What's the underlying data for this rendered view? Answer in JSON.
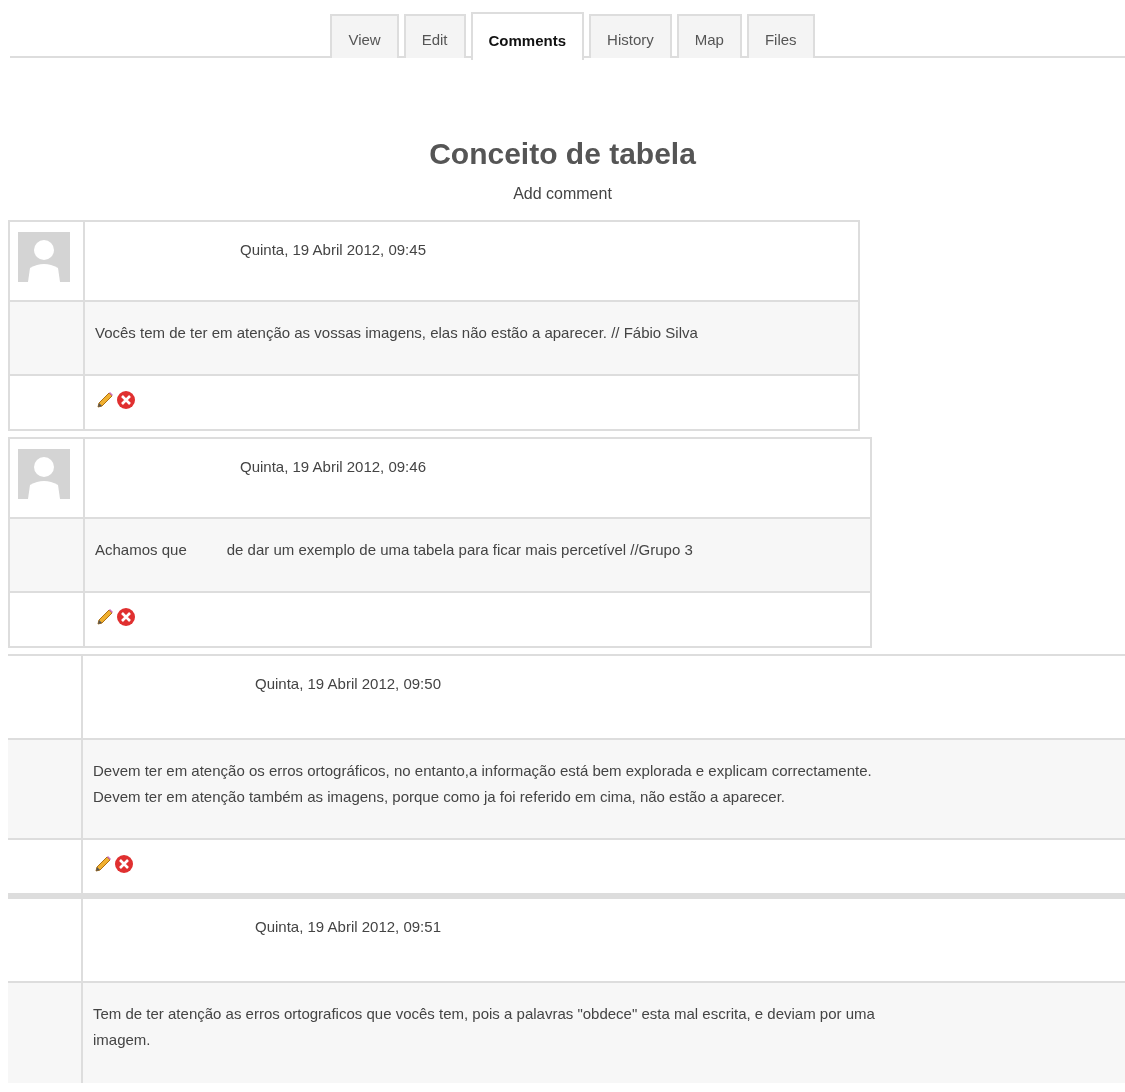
{
  "tabs": [
    {
      "label": "View",
      "selected": false
    },
    {
      "label": "Edit",
      "selected": false
    },
    {
      "label": "Comments",
      "selected": true
    },
    {
      "label": "History",
      "selected": false
    },
    {
      "label": "Map",
      "selected": false
    },
    {
      "label": "Files",
      "selected": false
    }
  ],
  "title": "Conceito de tabela",
  "add_comment": "Add comment",
  "comments": [
    {
      "kind": "avatar",
      "time": "Quinta, 19 Abril 2012, 09:45",
      "text_parts": [
        "Vocês tem de ter em atenção as vossas imagens, elas não estão a aparecer. // Fábio Silva"
      ]
    },
    {
      "kind": "avatar",
      "time": "Quinta, 19 Abril 2012, 09:46",
      "text_parts": [
        "Achamos que",
        "de dar um exemplo de uma tabela para ficar mais percetível  //Grupo 3"
      ]
    },
    {
      "kind": "plain",
      "time": "Quinta, 19 Abril 2012, 09:50",
      "text_parts": [
        "Devem ter em atenção os erros ortográficos, no entanto,a informação está bem explorada e explicam correctamente. Devem ter em atenção também as imagens, porque como ja foi referido em cima, não estão a aparecer."
      ],
      "actions": true
    },
    {
      "kind": "plain",
      "time": "Quinta, 19 Abril 2012, 09:51",
      "text_parts": [
        "Tem de ter atenção as erros ortograficos que vocês tem, pois a palavras \"obdece\" esta mal escrita, e deviam por uma imagem."
      ],
      "actions": false
    }
  ]
}
